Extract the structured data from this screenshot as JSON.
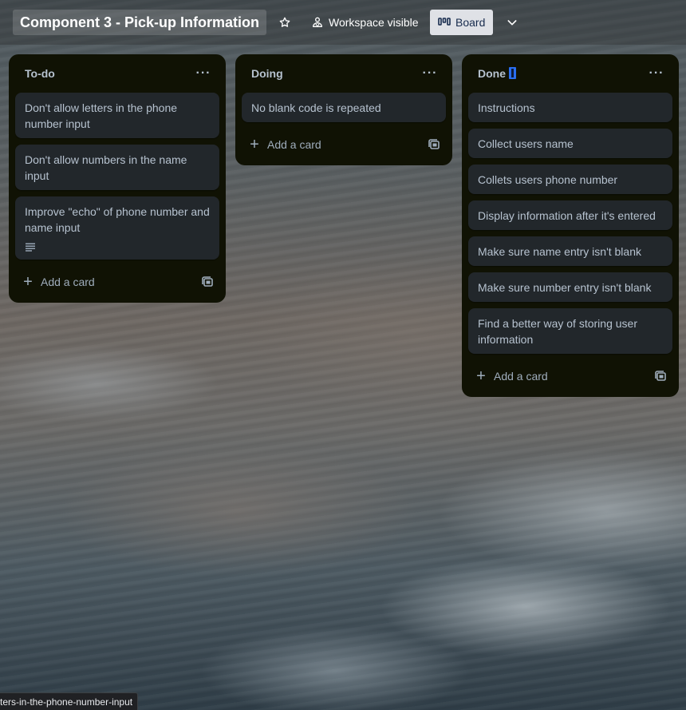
{
  "header": {
    "board_title": "Component 3 - Pick-up Information",
    "visibility_label": "Workspace visible",
    "view_label": "Board"
  },
  "lists": [
    {
      "title": "To-do",
      "cards": [
        "Don't allow letters in the phone number input",
        "Don't allow numbers in the name input",
        "Improve \"echo\" of phone number and name input"
      ],
      "add_label": "Add a card"
    },
    {
      "title": "Doing",
      "cards": [
        "No blank code is repeated"
      ],
      "add_label": "Add a card"
    },
    {
      "title": "Done",
      "cards": [
        "Instructions",
        "Collect users name",
        "Collets users phone number",
        "Display information after it's entered",
        "Make sure name entry isn't blank",
        "Make sure number entry isn't blank",
        "Find a better way of storing user information"
      ],
      "add_label": "Add a card"
    }
  ],
  "status_bar": {
    "url_text": "ters-in-the-phone-number-input"
  },
  "icons": {
    "star": "star-icon",
    "visibility": "people-icon",
    "board_view": "board-icon",
    "chevron": "chevron-down-icon",
    "list_menu": "ellipsis-icon",
    "add": "plus-icon",
    "template": "card-template-icon",
    "description": "description-icon",
    "done_badge": "blue-badge-icon"
  },
  "colors": {
    "list_bg": "#101204",
    "card_bg": "#22272b",
    "text": "#b6c2cf",
    "board_button_bg": "#dfe1e6",
    "badge_blue": "#2a6ef0"
  }
}
